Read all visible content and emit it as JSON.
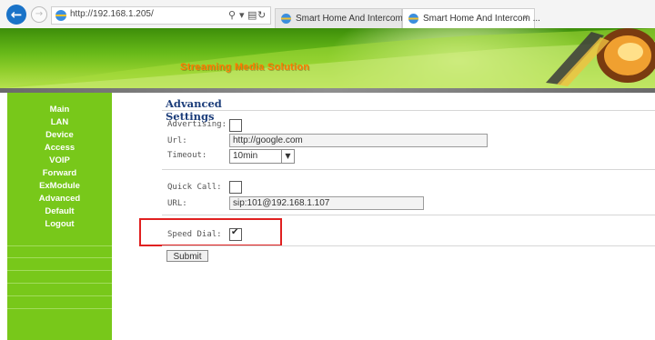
{
  "browser": {
    "url": "http://192.168.1.205/",
    "tabs": [
      {
        "title": "Smart Home And Intercom Sys...",
        "active": false
      },
      {
        "title": "Smart Home And Intercom ...",
        "active": true,
        "close": "×"
      }
    ]
  },
  "banner": {
    "title": "Streaming Media Solution"
  },
  "sidebar": {
    "items": [
      "Main",
      "LAN",
      "Device",
      "Access",
      "VOIP",
      "Forward",
      "ExModule",
      "Advanced",
      "Default",
      "Logout"
    ]
  },
  "main": {
    "section_title": "Advanced Settings",
    "advertising": {
      "label": "Advertising:",
      "checked": false
    },
    "url": {
      "label": "Url:",
      "value": "http://google.com"
    },
    "timeout": {
      "label": "Timeout:",
      "value": "10min"
    },
    "quick_call": {
      "label": "Quick Call:",
      "checked": false
    },
    "quick_url": {
      "label": "URL:",
      "value": "sip:101@192.168.1.107"
    },
    "speed_dial": {
      "label": "Speed Dial:",
      "checked": true
    },
    "submit_label": "Submit"
  },
  "colors": {
    "sidebar": "#78c81a",
    "banner_title": "#ff7a00",
    "section_title": "#1c3d7a",
    "highlight_box": "#e02020"
  },
  "icons": {
    "back": "back-arrow-icon",
    "forward": "forward-arrow-icon",
    "site": "ie-icon",
    "search": "search-icon",
    "compat": "compatibility-icon",
    "refresh": "refresh-icon",
    "close": "close-icon"
  }
}
